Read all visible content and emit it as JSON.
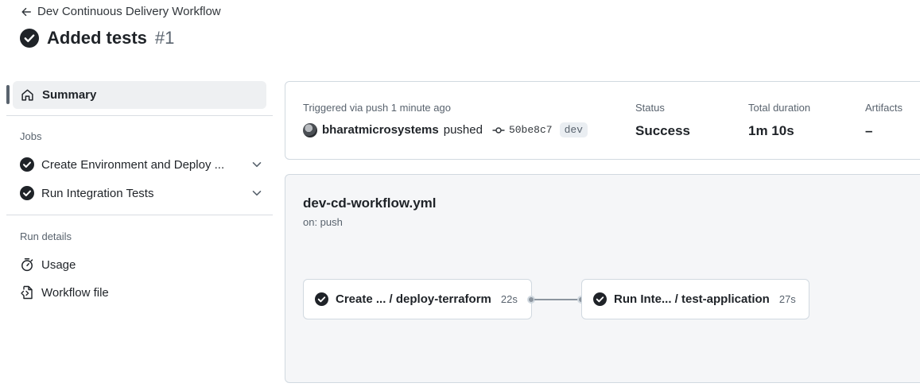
{
  "header": {
    "back_label": "Dev Continuous Delivery Workflow",
    "title": "Added tests",
    "run_number": "#1"
  },
  "sidebar": {
    "summary_label": "Summary",
    "jobs_heading": "Jobs",
    "jobs": [
      {
        "label": "Create Environment and Deploy ..."
      },
      {
        "label": "Run Integration Tests"
      }
    ],
    "run_details_heading": "Run details",
    "details": [
      {
        "label": "Usage",
        "icon": "stopwatch-icon"
      },
      {
        "label": "Workflow file",
        "icon": "file-code-icon"
      }
    ]
  },
  "run_info": {
    "trigger_text": "Triggered via push 1 minute ago",
    "actor": "bharatmicrosystems",
    "action": "pushed",
    "commit_sha": "50be8c7",
    "branch": "dev",
    "status_label": "Status",
    "status_value": "Success",
    "duration_label": "Total duration",
    "duration_value": "1m 10s",
    "artifacts_label": "Artifacts",
    "artifacts_value": "–"
  },
  "workflow": {
    "file_name": "dev-cd-workflow.yml",
    "trigger": "on: push",
    "nodes": [
      {
        "name": "Create ... / deploy-terraform",
        "duration": "22s"
      },
      {
        "name": "Run Inte...  / test-application",
        "duration": "27s"
      }
    ]
  },
  "colors": {
    "success": "#1f2328",
    "accent_gray": "#59636e",
    "border": "#d1d9e0"
  }
}
